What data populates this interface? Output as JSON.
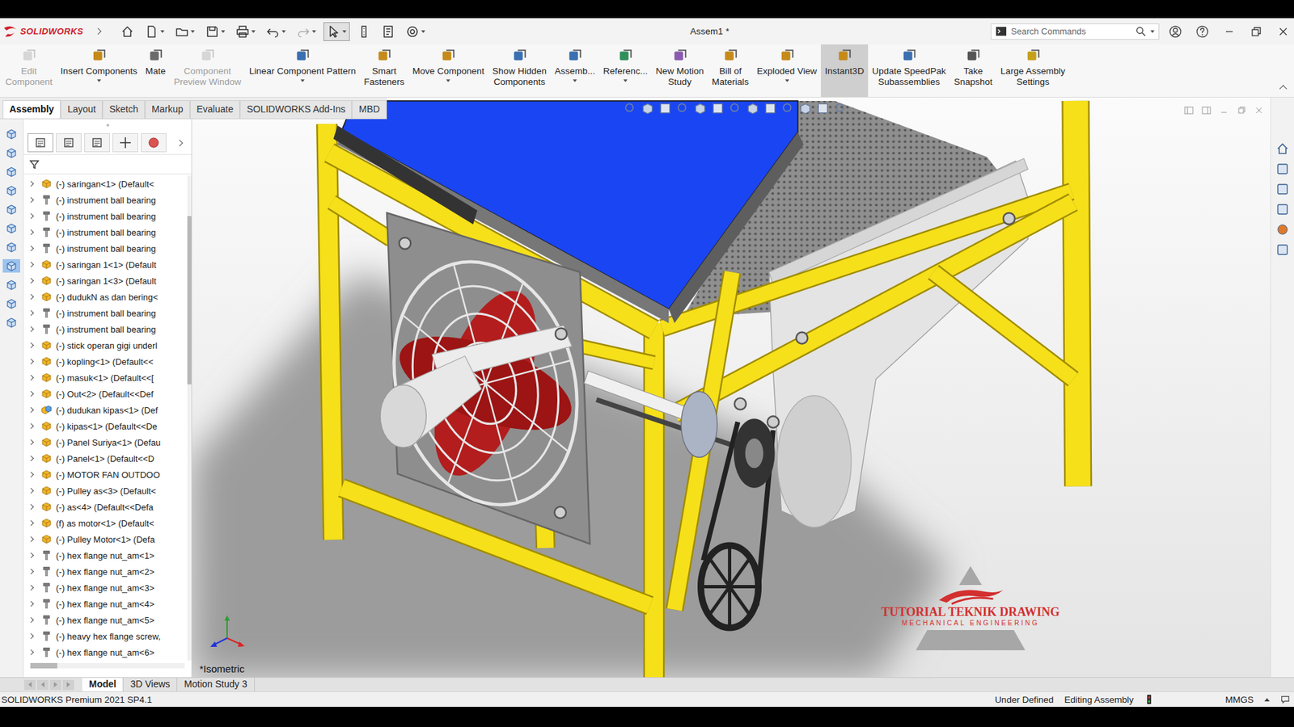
{
  "window": {
    "app": "SOLIDWORKS",
    "title": "Assem1 *"
  },
  "quick_access": [
    {
      "dropdown": false,
      "selected": false,
      "disabled": false
    },
    {
      "dropdown": true,
      "selected": false,
      "disabled": false
    },
    {
      "dropdown": true,
      "selected": false,
      "disabled": false
    },
    {
      "dropdown": true,
      "selected": false,
      "disabled": false
    },
    {
      "dropdown": true,
      "selected": false,
      "disabled": false
    },
    {
      "dropdown": true,
      "selected": false,
      "disabled": false
    },
    {
      "dropdown": true,
      "selected": false,
      "disabled": true
    },
    {
      "dropdown": true,
      "selected": true,
      "disabled": false
    },
    {
      "dropdown": false,
      "selected": false,
      "disabled": false
    },
    {
      "dropdown": false,
      "selected": false,
      "disabled": false
    },
    {
      "dropdown": true,
      "selected": false,
      "disabled": false
    }
  ],
  "search": {
    "placeholder": "Search Commands"
  },
  "ribbon": [
    {
      "lines": [
        "Edit",
        "Component"
      ],
      "dropdown": false,
      "disabled": true,
      "selected": false
    },
    {
      "lines": [
        "Insert Components"
      ],
      "dropdown": true,
      "disabled": false,
      "selected": false
    },
    {
      "lines": [
        "Mate"
      ],
      "dropdown": false,
      "disabled": false,
      "selected": false
    },
    {
      "lines": [
        "Component",
        "Preview Window"
      ],
      "dropdown": false,
      "disabled": true,
      "selected": false
    },
    {
      "lines": [
        "Linear Component Pattern"
      ],
      "dropdown": true,
      "disabled": false,
      "selected": false
    },
    {
      "lines": [
        "Smart",
        "Fasteners"
      ],
      "dropdown": false,
      "disabled": false,
      "selected": false
    },
    {
      "lines": [
        "Move Component"
      ],
      "dropdown": true,
      "disabled": false,
      "selected": false
    },
    {
      "lines": [
        "Show Hidden",
        "Components"
      ],
      "dropdown": false,
      "disabled": false,
      "selected": false
    },
    {
      "lines": [
        "Assemb..."
      ],
      "dropdown": true,
      "disabled": false,
      "selected": false
    },
    {
      "lines": [
        "Referenc..."
      ],
      "dropdown": true,
      "disabled": false,
      "selected": false
    },
    {
      "lines": [
        "New Motion",
        "Study"
      ],
      "dropdown": false,
      "disabled": false,
      "selected": false
    },
    {
      "lines": [
        "Bill of",
        "Materials"
      ],
      "dropdown": false,
      "disabled": false,
      "selected": false
    },
    {
      "lines": [
        "Exploded View"
      ],
      "dropdown": true,
      "disabled": false,
      "selected": false
    },
    {
      "lines": [
        "Instant3D"
      ],
      "dropdown": false,
      "disabled": false,
      "selected": true
    },
    {
      "lines": [
        "Update SpeedPak",
        "Subassemblies"
      ],
      "dropdown": false,
      "disabled": false,
      "selected": false
    },
    {
      "lines": [
        "Take",
        "Snapshot"
      ],
      "dropdown": false,
      "disabled": false,
      "selected": false
    },
    {
      "lines": [
        "Large Assembly",
        "Settings"
      ],
      "dropdown": false,
      "disabled": false,
      "selected": false
    }
  ],
  "command_tabs": [
    {
      "label": "Assembly",
      "selected": true
    },
    {
      "label": "Layout",
      "selected": false
    },
    {
      "label": "Sketch",
      "selected": false
    },
    {
      "label": "Markup",
      "selected": false
    },
    {
      "label": "Evaluate",
      "selected": false
    },
    {
      "label": "SOLIDWORKS Add-Ins",
      "selected": false
    },
    {
      "label": "MBD",
      "selected": false
    }
  ],
  "left_toolbar": [
    {
      "selected": false
    },
    {
      "selected": false
    },
    {
      "selected": false
    },
    {
      "selected": false
    },
    {
      "selected": false
    },
    {
      "selected": false
    },
    {
      "selected": false
    },
    {
      "selected": true
    },
    {
      "selected": false
    },
    {
      "selected": false
    },
    {
      "selected": false
    }
  ],
  "manager_tabs": [
    {
      "selected": true
    },
    {
      "selected": false
    },
    {
      "selected": false
    },
    {
      "selected": false
    },
    {
      "selected": false
    }
  ],
  "tree": {
    "items": [
      {
        "label": "(-) saringan<1> (Default<",
        "kind": "part",
        "expanded": false
      },
      {
        "label": "(-) instrument ball bearing",
        "kind": "toolbox",
        "expanded": false
      },
      {
        "label": "(-) instrument ball bearing",
        "kind": "toolbox",
        "expanded": false
      },
      {
        "label": "(-) instrument ball bearing",
        "kind": "toolbox",
        "expanded": false
      },
      {
        "label": "(-) instrument ball bearing",
        "kind": "toolbox",
        "expanded": false
      },
      {
        "label": "(-) saringan 1<1> (Default",
        "kind": "part",
        "expanded": false
      },
      {
        "label": "(-) saringan 1<3> (Default",
        "kind": "part",
        "expanded": false
      },
      {
        "label": "(-) dudukN as dan bering<",
        "kind": "part",
        "expanded": false
      },
      {
        "label": "(-) instrument ball bearing",
        "kind": "toolbox",
        "expanded": false
      },
      {
        "label": "(-) instrument ball bearing",
        "kind": "toolbox",
        "expanded": false
      },
      {
        "label": "(-) stick operan gigi underl",
        "kind": "part",
        "expanded": false
      },
      {
        "label": "(-) kopling<1> (Default<<",
        "kind": "part",
        "expanded": false
      },
      {
        "label": "(-) masuk<1> (Default<<[",
        "kind": "part",
        "expanded": false
      },
      {
        "label": "(-) Out<2> (Default<<Def",
        "kind": "part",
        "expanded": false
      },
      {
        "label": "(-) dudukan kipas<1> (Def",
        "kind": "assembly",
        "expanded": false
      },
      {
        "label": "(-) kipas<1> (Default<<De",
        "kind": "part",
        "expanded": false
      },
      {
        "label": "(-) Panel Suriya<1> (Defau",
        "kind": "part",
        "expanded": false
      },
      {
        "label": "(-) Panel<1> (Default<<D",
        "kind": "part",
        "expanded": false
      },
      {
        "label": "(-) MOTOR FAN OUTDOO",
        "kind": "part",
        "expanded": false
      },
      {
        "label": "(-) Pulley as<3> (Default<",
        "kind": "part",
        "expanded": false
      },
      {
        "label": "(-) as<4> (Default<<Defa",
        "kind": "part",
        "expanded": false
      },
      {
        "label": "(f) as motor<1> (Default<",
        "kind": "part",
        "expanded": false
      },
      {
        "label": "(-) Pulley Motor<1> (Defa",
        "kind": "part",
        "expanded": false
      },
      {
        "label": "(-) hex flange nut_am<1>",
        "kind": "toolbox",
        "expanded": false
      },
      {
        "label": "(-) hex flange nut_am<2>",
        "kind": "toolbox",
        "expanded": false
      },
      {
        "label": "(-) hex flange nut_am<3>",
        "kind": "toolbox",
        "expanded": false
      },
      {
        "label": "(-) hex flange nut_am<4>",
        "kind": "toolbox",
        "expanded": false
      },
      {
        "label": "(-) hex flange nut_am<5>",
        "kind": "toolbox",
        "expanded": false
      },
      {
        "label": "(-) heavy hex flange screw,",
        "kind": "toolbox",
        "expanded": false
      },
      {
        "label": "(-) hex flange nut_am<6>",
        "kind": "toolbox",
        "expanded": false
      }
    ]
  },
  "viewport": {
    "view_label": "*Isometric"
  },
  "watermark": {
    "title": "TUTORIAL TEKNIK DRAWING",
    "subtitle": "MECHANICAL ENGINEERING"
  },
  "bottom_tabs": [
    {
      "label": "Model",
      "selected": true
    },
    {
      "label": "3D Views",
      "selected": false
    },
    {
      "label": "Motion Study 3",
      "selected": false
    }
  ],
  "status_bar": {
    "version": "SOLIDWORKS Premium 2021 SP4.1",
    "status": "Under Defined",
    "mode": "Editing Assembly",
    "units": "MMGS"
  }
}
